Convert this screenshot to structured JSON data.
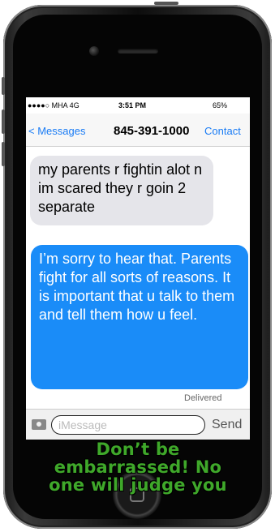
{
  "status": {
    "carrier": "●●●●○ MHA 4G",
    "time": "3:51 PM",
    "battery": "65%"
  },
  "nav": {
    "back_label": "< Messages",
    "title": "845-391-1000",
    "contact_label": "Contact"
  },
  "messages": [
    {
      "direction": "incoming",
      "text": "my parents r fightin alot n im scared they r goin 2 separate"
    },
    {
      "direction": "outgoing",
      "text": "I’m sorry to hear that. Parents fight for all sorts of reasons. It is important that u talk to them and tell them how u feel."
    }
  ],
  "delivered_label": "Delivered",
  "composer": {
    "placeholder": "iMessage",
    "value": "",
    "send_label": "Send",
    "camera_icon": "camera-icon"
  },
  "caption": "Don’t be embarrassed! No one will judge you",
  "colors": {
    "accent": "#1a7cf5",
    "outgoing_bubble": "#1a8cf8",
    "incoming_bubble": "#e5e5ea",
    "caption": "#3fa82a"
  }
}
